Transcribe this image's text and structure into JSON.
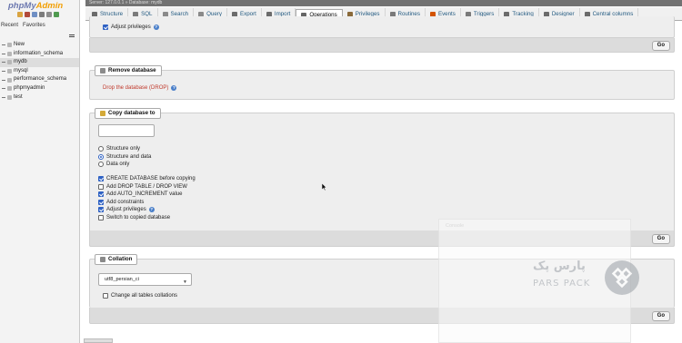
{
  "app": {
    "logo_php": "php",
    "logo_my": "My",
    "logo_admin": "Admin"
  },
  "nav": {
    "tabs": [
      "Recent",
      "Favorites"
    ],
    "databases": [
      {
        "label": "New",
        "active": false
      },
      {
        "label": "information_schema",
        "active": false
      },
      {
        "label": "mydb",
        "active": true
      },
      {
        "label": "mysql",
        "active": false
      },
      {
        "label": "performance_schema",
        "active": false
      },
      {
        "label": "phpmyadmin",
        "active": false
      },
      {
        "label": "test",
        "active": false
      }
    ]
  },
  "breadcrumb": {
    "text": "Server: 127.0.0.1 » Database: mydb"
  },
  "tabs": [
    {
      "label": "Structure",
      "icon": "structure-icon",
      "color": "#6b6b6b",
      "active": false
    },
    {
      "label": "SQL",
      "icon": "sql-icon",
      "color": "#7a7a7a",
      "active": false
    },
    {
      "label": "Search",
      "icon": "search-icon",
      "color": "#8a8a8a",
      "active": false
    },
    {
      "label": "Query",
      "icon": "query-icon",
      "color": "#8a8a8a",
      "active": false
    },
    {
      "label": "Export",
      "icon": "export-icon",
      "color": "#6b6b6b",
      "active": false
    },
    {
      "label": "Import",
      "icon": "import-icon",
      "color": "#6b6b6b",
      "active": false
    },
    {
      "label": "Operations",
      "icon": "wrench-icon",
      "color": "#666666",
      "active": true
    },
    {
      "label": "Privileges",
      "icon": "privileges-icon",
      "color": "#8a6a3a",
      "active": false
    },
    {
      "label": "Routines",
      "icon": "routines-icon",
      "color": "#7a7a7a",
      "active": false
    },
    {
      "label": "Events",
      "icon": "events-icon",
      "color": "#d35400",
      "active": false
    },
    {
      "label": "Triggers",
      "icon": "triggers-icon",
      "color": "#7a7a7a",
      "active": false
    },
    {
      "label": "Tracking",
      "icon": "tracking-icon",
      "color": "#6b6b6b",
      "active": false
    },
    {
      "label": "Designer",
      "icon": "designer-icon",
      "color": "#6b6b6b",
      "active": false
    },
    {
      "label": "Central columns",
      "icon": "central-columns-icon",
      "color": "#6b6b6b",
      "active": false
    }
  ],
  "rename_section": {
    "adjust_privileges": "Adjust privileges",
    "go": "Go"
  },
  "remove_section": {
    "legend": "Remove database",
    "drop_link": "Drop the database (DROP)"
  },
  "copy_section": {
    "legend": "Copy database to",
    "new_name_value": "",
    "radios": [
      {
        "label": "Structure only",
        "checked": false
      },
      {
        "label": "Structure and data",
        "checked": true
      },
      {
        "label": "Data only",
        "checked": false
      }
    ],
    "checkboxes": [
      {
        "label": "CREATE DATABASE before copying",
        "checked": true,
        "help": false
      },
      {
        "label": "Add DROP TABLE / DROP VIEW",
        "checked": false,
        "help": false
      },
      {
        "label": "Add AUTO_INCREMENT value",
        "checked": true,
        "help": false
      },
      {
        "label": "Add constraints",
        "checked": true,
        "help": false
      },
      {
        "label": "Adjust privileges",
        "checked": true,
        "help": true
      },
      {
        "label": "Switch to copied database",
        "checked": false,
        "help": false
      }
    ],
    "go": "Go"
  },
  "collation_section": {
    "legend": "Collation",
    "selected": "utf8_persian_ci",
    "change_all": "Change all tables collations",
    "go": "Go"
  },
  "overlay": {
    "label": "Console"
  },
  "watermark": {
    "fa": "پارس پک",
    "en": "PARS PACK"
  },
  "colors": {
    "logo_blue": "#6c78af",
    "logo_orange": "#f29f05",
    "link_red": "#c0392b",
    "checkbox_blue": "#2f62c4"
  }
}
